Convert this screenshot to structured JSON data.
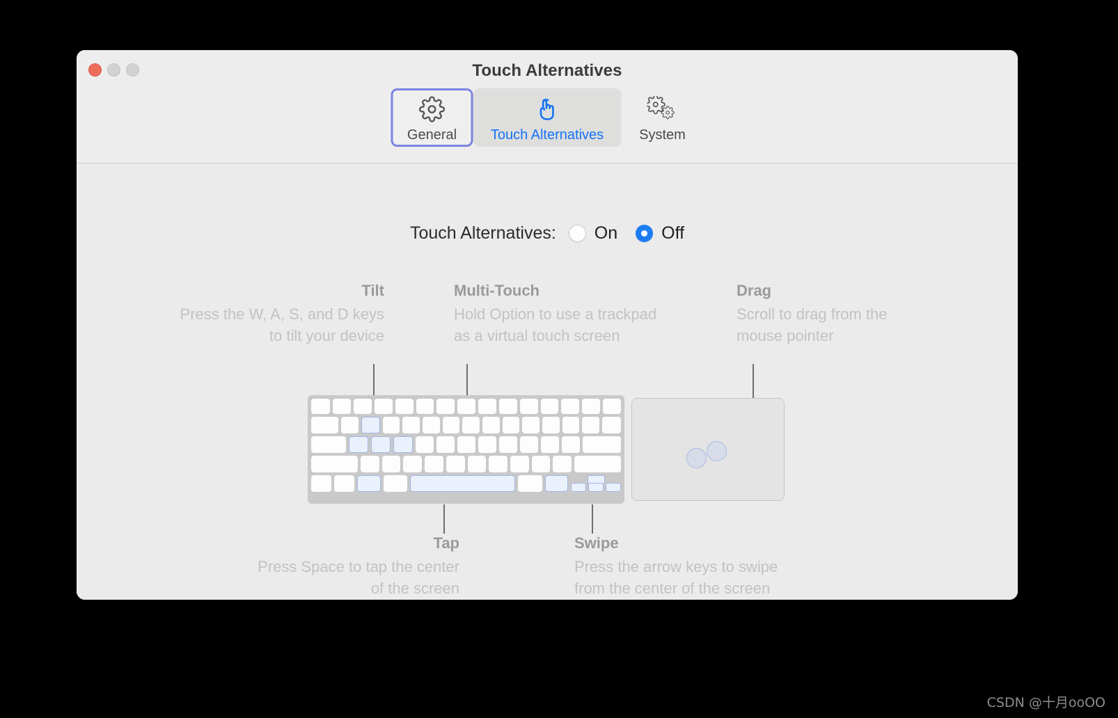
{
  "window": {
    "title": "Touch Alternatives",
    "traffic_lights": [
      {
        "name": "close",
        "color": "#ef6c5c"
      },
      {
        "name": "minimize",
        "color": "#d2d2d2"
      },
      {
        "name": "maximize",
        "color": "#d2d2d2"
      }
    ]
  },
  "toolbar": {
    "tabs": [
      {
        "label": "General",
        "icon": "gear-icon",
        "state": "focused"
      },
      {
        "label": "Touch Alternatives",
        "icon": "touch-pointer-icon",
        "state": "selected"
      },
      {
        "label": "System",
        "icon": "double-gear-icon",
        "state": "normal"
      }
    ]
  },
  "setting": {
    "label": "Touch Alternatives:",
    "options": [
      {
        "value": "On",
        "selected": false
      },
      {
        "value": "Off",
        "selected": true
      }
    ]
  },
  "annotations": {
    "tilt": {
      "title": "Tilt",
      "description": "Press the W, A, S, and D keys\nto tilt your device"
    },
    "multi_touch": {
      "title": "Multi-Touch",
      "description": "Hold Option to use a trackpad\nas a virtual touch screen"
    },
    "drag": {
      "title": "Drag",
      "description": "Scroll to drag from the\nmouse pointer"
    },
    "tap": {
      "title": "Tap",
      "description": "Press Space to tap the center\nof the screen"
    },
    "swipe": {
      "title": "Swipe",
      "description": "Press the arrow keys to swipe\nfrom the center of the screen"
    }
  },
  "illustration": {
    "keyboard_name": "keyboard-diagram",
    "trackpad_name": "trackpad-diagram",
    "highlighted_keys": [
      "W",
      "A",
      "S",
      "D",
      "Option",
      "Space",
      "Option",
      "Arrow Keys"
    ]
  },
  "colors": {
    "accent_blue": "#1372f5",
    "radio_on": "#1c7cf2",
    "focus_ring": "#7b83e0",
    "key_highlight_fill": "#ebf0fd",
    "key_highlight_border": "#9fb6e4",
    "window_bg": "#ececec"
  },
  "watermark": {
    "text": "CSDN @十月ooOO"
  }
}
